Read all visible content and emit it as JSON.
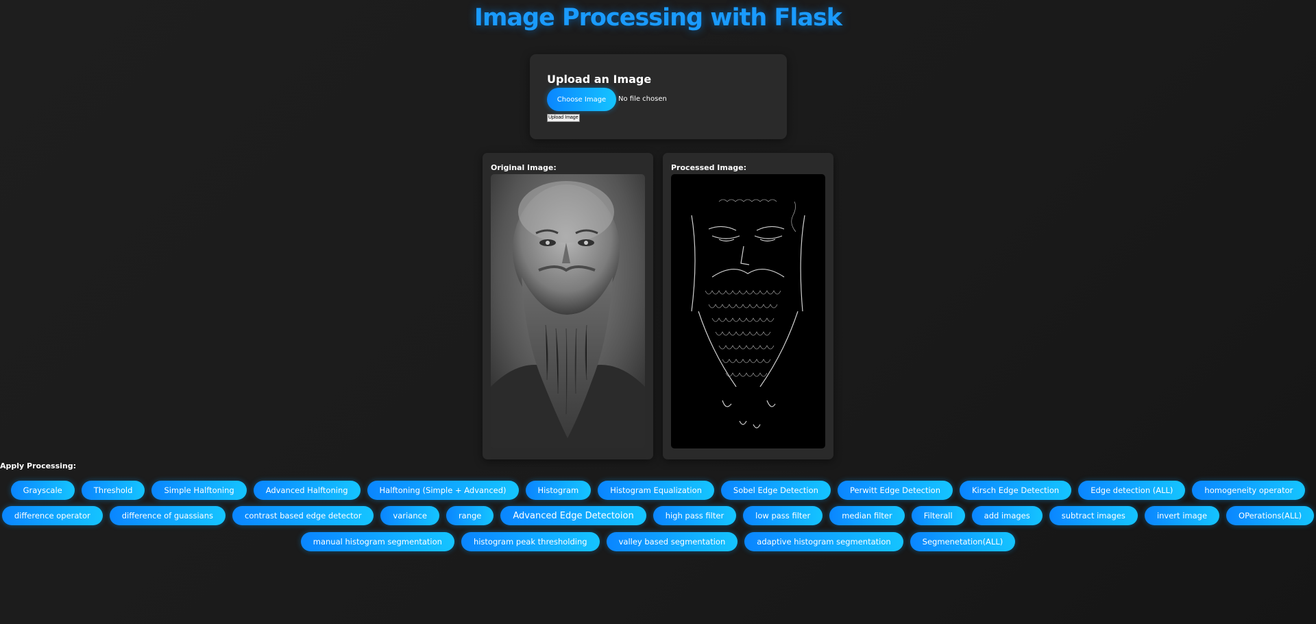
{
  "header": {
    "title": "Image Processing with Flask"
  },
  "upload": {
    "heading": "Upload an Image",
    "choose_label": "Choose Image",
    "file_status": "No file chosen",
    "submit_label": "Upload Image"
  },
  "images": {
    "original_label": "Original Image:",
    "processed_label": "Processed Image:"
  },
  "processing": {
    "label": "Apply Processing:",
    "row1": [
      "Grayscale",
      "Threshold",
      "Simple Halftoning",
      "Advanced Halftoning",
      "Halftoning (Simple + Advanced)",
      "Histogram",
      "Histogram Equalization",
      "Sobel Edge Detection",
      "Perwitt Edge Detection",
      "Kirsch Edge Detection",
      "Edge detection (ALL)",
      "homogeneity operator"
    ],
    "row2": [
      "difference operator",
      "difference of guassians",
      "contrast based edge detector",
      "variance",
      "range",
      "Advanced Edge Detectoion",
      "high pass filter",
      "low pass filter",
      "median filter",
      "Filterall",
      "add images",
      "subtract images",
      "invert image",
      "OPerations(ALL)"
    ],
    "row3": [
      "manual histogram segmentation",
      "histogram peak thresholding",
      "valley based segmentation",
      "adaptive histogram segmentation",
      "Segmenetation(ALL)"
    ]
  },
  "colors": {
    "accent": "#1a9bff",
    "button_gradient_start": "#0a86ff",
    "button_gradient_end": "#15c4ff",
    "card_bg": "#2a2a2a",
    "page_bg": "#1c1c1c"
  }
}
